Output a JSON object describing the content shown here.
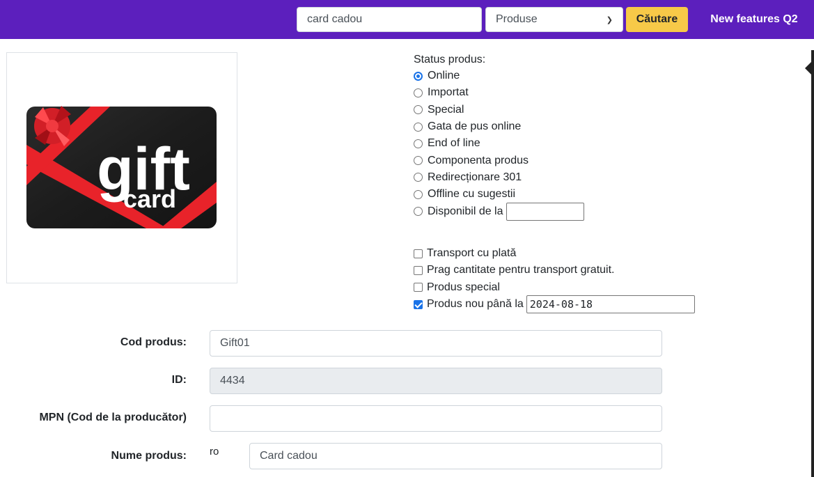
{
  "topbar": {
    "search_value": "card cadou",
    "category_selected": "Produse",
    "search_button": "Căutare",
    "nav_link": "New features Q2",
    "bg_color": "#5c1fbd",
    "button_color": "#f7c948"
  },
  "product_image": {
    "gift_text": "gift",
    "card_text": "card"
  },
  "status": {
    "title": "Status produs:",
    "options": [
      {
        "label": "Online",
        "checked": true
      },
      {
        "label": "Importat",
        "checked": false
      },
      {
        "label": "Special",
        "checked": false
      },
      {
        "label": "Gata de pus online",
        "checked": false
      },
      {
        "label": "End of line",
        "checked": false
      },
      {
        "label": "Componenta produs",
        "checked": false
      },
      {
        "label": "Redirecționare 301",
        "checked": false
      },
      {
        "label": "Offline cu sugestii",
        "checked": false
      },
      {
        "label": "Disponibil de la",
        "checked": false
      }
    ]
  },
  "flags": {
    "items": [
      {
        "label": "Transport cu plată",
        "checked": false
      },
      {
        "label": "Prag cantitate pentru transport gratuit.",
        "checked": false
      },
      {
        "label": "Produs special",
        "checked": false
      },
      {
        "label": "Produs nou până la",
        "checked": true
      }
    ],
    "new_until_date": "2024-08-18"
  },
  "form": {
    "cod_produs_label": "Cod produs:",
    "cod_produs_value": "Gift01",
    "id_label": "ID:",
    "id_value": "4434",
    "mpn_label": "MPN (Cod de la producător)",
    "mpn_value": "",
    "nume_label": "Nume produs:",
    "nume_lang": "ro",
    "nume_value": "Card cadou"
  }
}
